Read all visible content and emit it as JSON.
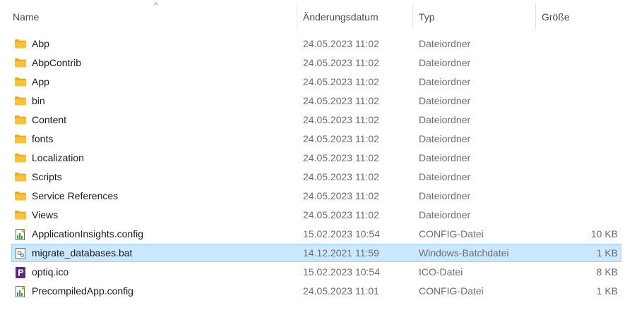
{
  "columns": {
    "name": "Name",
    "date": "Änderungsdatum",
    "type": "Typ",
    "size": "Größe"
  },
  "sort_indicator": "^",
  "files": [
    {
      "name": "Abp",
      "date": "24.05.2023 11:02",
      "type": "Dateiordner",
      "size": "",
      "icon": "folder-icon"
    },
    {
      "name": "AbpContrib",
      "date": "24.05.2023 11:02",
      "type": "Dateiordner",
      "size": "",
      "icon": "folder-icon"
    },
    {
      "name": "App",
      "date": "24.05.2023 11:02",
      "type": "Dateiordner",
      "size": "",
      "icon": "folder-icon"
    },
    {
      "name": "bin",
      "date": "24.05.2023 11:02",
      "type": "Dateiordner",
      "size": "",
      "icon": "folder-icon"
    },
    {
      "name": "Content",
      "date": "24.05.2023 11:02",
      "type": "Dateiordner",
      "size": "",
      "icon": "folder-icon"
    },
    {
      "name": "fonts",
      "date": "24.05.2023 11:02",
      "type": "Dateiordner",
      "size": "",
      "icon": "folder-icon"
    },
    {
      "name": "Localization",
      "date": "24.05.2023 11:02",
      "type": "Dateiordner",
      "size": "",
      "icon": "folder-icon"
    },
    {
      "name": "Scripts",
      "date": "24.05.2023 11:02",
      "type": "Dateiordner",
      "size": "",
      "icon": "folder-icon"
    },
    {
      "name": "Service References",
      "date": "24.05.2023 11:02",
      "type": "Dateiordner",
      "size": "",
      "icon": "folder-icon"
    },
    {
      "name": "Views",
      "date": "24.05.2023 11:02",
      "type": "Dateiordner",
      "size": "",
      "icon": "folder-icon"
    },
    {
      "name": "ApplicationInsights.config",
      "date": "15.02.2023 10:54",
      "type": "CONFIG-Datei",
      "size": "10 KB",
      "icon": "config-file-icon"
    },
    {
      "name": "migrate_databases.bat",
      "date": "14.12.2021 11:59",
      "type": "Windows-Batchdatei",
      "size": "1 KB",
      "icon": "batch-file-icon",
      "selected": true
    },
    {
      "name": "optiq.ico",
      "date": "15.02.2023 10:54",
      "type": "ICO-Datei",
      "size": "8 KB",
      "icon": "ico-file-icon"
    },
    {
      "name": "PrecompiledApp.config",
      "date": "24.05.2023 11:01",
      "type": "CONFIG-Datei",
      "size": "1 KB",
      "icon": "config-file-icon"
    }
  ],
  "colors": {
    "selection_bg": "#cce8ff",
    "selection_border": "#99d1ff",
    "folder": "#f8c33a",
    "ico_purple": "#5b2a86"
  }
}
